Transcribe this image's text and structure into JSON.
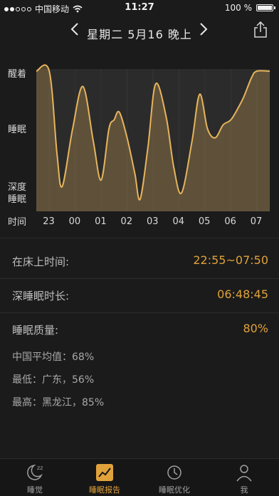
{
  "status": {
    "carrier": "中国移动",
    "time": "11:27",
    "battery": "100 %"
  },
  "nav": {
    "title": "星期二  5月16  晚上",
    "prev_icon": "chevron-left-icon",
    "next_icon": "chevron-right-icon",
    "share_icon": "share-icon"
  },
  "chart": {
    "y_labels": {
      "awake": "醒着",
      "sleep": "睡眠",
      "deep_line1": "深度",
      "deep_line2": "睡眠",
      "time": "时间"
    },
    "x_labels": [
      "23",
      "00",
      "01",
      "02",
      "03",
      "04",
      "05",
      "06",
      "07"
    ],
    "accent": "#e6b45c"
  },
  "chart_data": {
    "type": "area",
    "categories": [
      "23",
      "00",
      "01",
      "02",
      "03",
      "04",
      "05",
      "06",
      "07"
    ],
    "y_levels": [
      "深度睡眠",
      "睡眠",
      "醒着"
    ],
    "series": [
      {
        "values_note": "",
        "points": [
          [
            0.0,
            1.0
          ],
          [
            0.5,
            1.0
          ],
          [
            0.8,
            0.35
          ],
          [
            1.0,
            0.1
          ],
          [
            1.4,
            0.55
          ],
          [
            1.8,
            0.88
          ],
          [
            2.2,
            0.45
          ],
          [
            2.5,
            0.15
          ],
          [
            2.8,
            0.55
          ],
          [
            3.0,
            0.62
          ],
          [
            3.2,
            0.68
          ],
          [
            3.5,
            0.48
          ],
          [
            3.8,
            0.2
          ],
          [
            4.0,
            0.0
          ],
          [
            4.3,
            0.4
          ],
          [
            4.6,
            0.9
          ],
          [
            5.0,
            0.65
          ],
          [
            5.3,
            0.25
          ],
          [
            5.6,
            0.05
          ],
          [
            6.0,
            0.45
          ],
          [
            6.3,
            0.82
          ],
          [
            6.6,
            0.55
          ],
          [
            6.9,
            0.48
          ],
          [
            7.2,
            0.58
          ],
          [
            7.5,
            0.62
          ],
          [
            7.8,
            0.72
          ],
          [
            8.0,
            0.8
          ],
          [
            8.3,
            0.95
          ],
          [
            8.5,
            1.0
          ],
          [
            9.0,
            1.0
          ]
        ]
      }
    ],
    "ylim": [
      0,
      1
    ]
  },
  "info": {
    "in_bed_label": "在床上时间:",
    "in_bed_value": "22:55~07:50",
    "deep_label": "深睡眠时长:",
    "deep_value": "06:48:45",
    "quality_label": "睡眠质量:",
    "quality_value": "80%",
    "avg": "中国平均值：68%",
    "lowest": "最低：广东，56%",
    "highest": "最高：黑龙江，85%"
  },
  "tabs": [
    {
      "label": "睡觉",
      "icon": "moon-zzz-icon",
      "active": false
    },
    {
      "label": "睡眠报告",
      "icon": "report-chart-icon",
      "active": true
    },
    {
      "label": "睡眠优化",
      "icon": "optimize-icon",
      "active": false
    },
    {
      "label": "我",
      "icon": "person-icon",
      "active": false
    }
  ]
}
